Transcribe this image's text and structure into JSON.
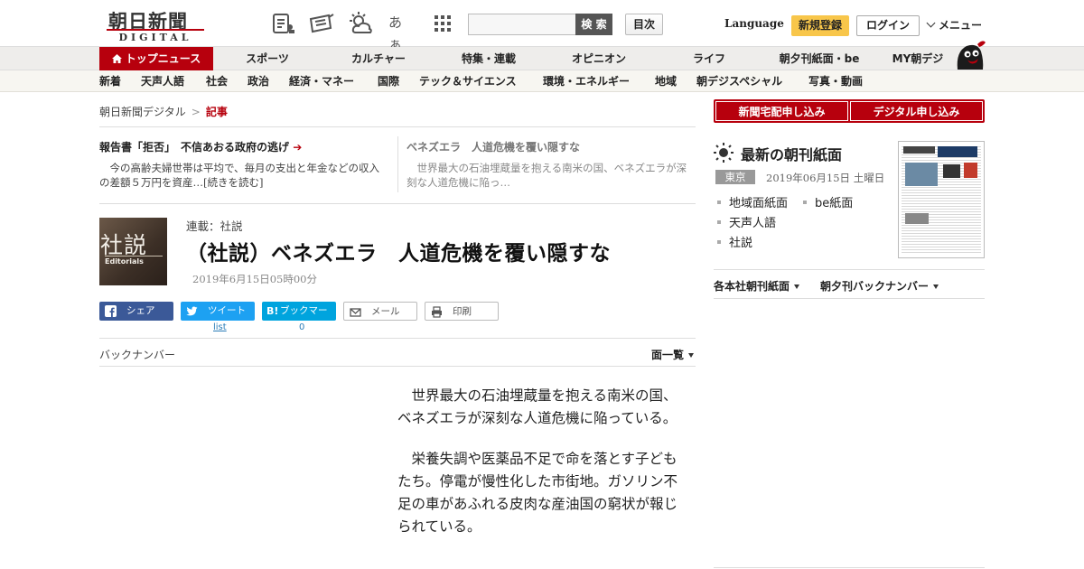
{
  "header": {
    "logo_jp": "朝日新聞",
    "logo_en": "DIGITAL",
    "search_button": "検 索",
    "search_placeholder": "",
    "toc_button": "目次",
    "icon_kana": "あぁ",
    "language_link": "Language",
    "register_button": "新規登録",
    "login_button": "ログイン",
    "menu_button": "メニュー"
  },
  "nav_primary": [
    {
      "label": "トップニュース",
      "active": true
    },
    {
      "label": "スポーツ"
    },
    {
      "label": "カルチャー"
    },
    {
      "label": "特集・連載"
    },
    {
      "label": "オピニオン"
    },
    {
      "label": "ライフ"
    },
    {
      "label": "朝夕刊紙面・be"
    },
    {
      "label": "MY朝デジ"
    }
  ],
  "nav_secondary": [
    {
      "label": "新着"
    },
    {
      "label": "天声人語"
    },
    {
      "label": "社会"
    },
    {
      "label": "政治"
    },
    {
      "label": "経済・マネー"
    },
    {
      "label": "国際"
    },
    {
      "label": "テック＆サイエンス"
    },
    {
      "label": "環境・エネルギー"
    },
    {
      "label": "地域"
    },
    {
      "label": "朝デジスペシャル"
    },
    {
      "label": "写真・動画"
    }
  ],
  "breadcrumb": {
    "home": "朝日新聞デジタル",
    "separator": ">",
    "current": "記事"
  },
  "related": [
    {
      "title": "報告書「拒否」　不信あおる政府の逃げ",
      "arrow": "➔",
      "body": "今の高齢夫婦世帯は平均で、毎月の支出と年金などの収入の差額５万円を資産…[続きを読む]"
    },
    {
      "title": "ベネズエラ　人道危機を覆い隠すな",
      "body": "世界最大の石油埋蔵量を抱える南米の国、ベネズエラが深刻な人道危機に陥っ…"
    }
  ],
  "article": {
    "thumb_kanji": "社説",
    "thumb_en": "Editorials",
    "series": "連載：社説",
    "headline": "（社説）ベネズエラ　人道危機を覆い隠すな",
    "date": "2019年6月15日05時00分",
    "paragraphs": [
      "世界最大の石油埋蔵量を抱える南米の国、ベネズエラが深刻な人道危機に陥っている。",
      "栄養失調や医薬品不足で命を落とす子どもたち。停電が慢性化した市街地。ガソリン不足の車があふれる皮肉な産油国の窮状が報じられている。"
    ]
  },
  "share": {
    "facebook": "シェア",
    "twitter": "ツイート",
    "twitter_count": "list",
    "hatena": "ブックマーク",
    "hatena_count": "0",
    "mail": "メール",
    "print": "印刷"
  },
  "backnumber": {
    "label": "バックナンバー",
    "page_list": "面一覧"
  },
  "sidebar": {
    "delivery_button": "新聞宅配申し込み",
    "digital_button": "デジタル申し込み",
    "paper_title": "最新の朝刊紙面",
    "location": "東京",
    "paper_date": "2019年06月15日 土曜日",
    "links": [
      "地域面紙面",
      "be紙面",
      "天声人語",
      "社説"
    ],
    "sub_links": [
      "各本社朝刊紙面",
      "朝夕刊バックナンバー"
    ]
  },
  "colors": {
    "brand_red": "#b7000d",
    "register_yellow": "#f8c64a",
    "facebook_blue": "#3b5998",
    "twitter_blue": "#1da1f2",
    "hatena_blue": "#00a4de"
  }
}
